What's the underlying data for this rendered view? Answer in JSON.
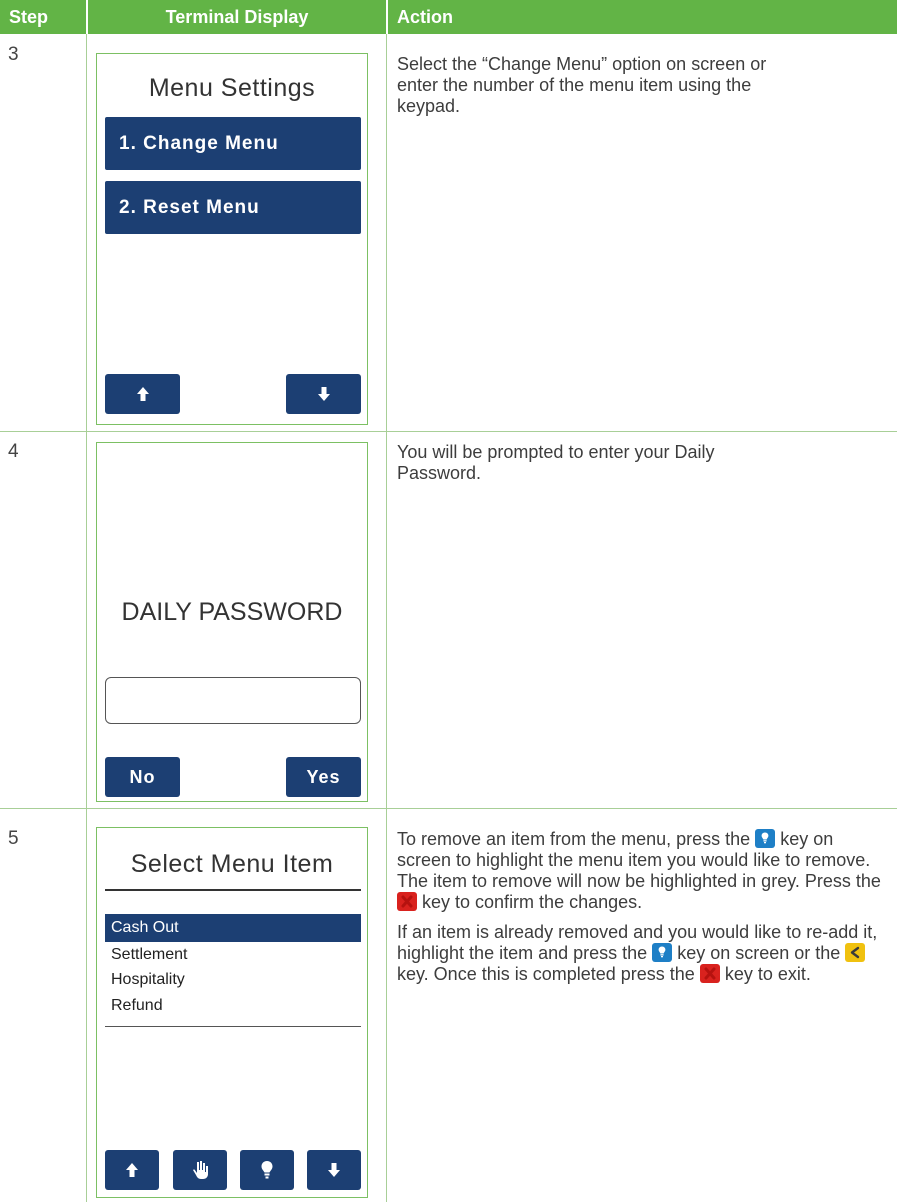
{
  "header": {
    "step": "Step",
    "terminal_display": "Terminal Display",
    "action": "Action"
  },
  "rows": [
    {
      "step": "3",
      "screen": {
        "title": "Menu Settings",
        "buttons": [
          "1. Change Menu",
          "2. Reset Menu"
        ],
        "nav": [
          "up-arrow-icon",
          "down-arrow-icon"
        ]
      },
      "action": "Select the “Change Menu” option on screen or enter the number of the menu item using the keypad."
    },
    {
      "step": "4",
      "screen": {
        "title": "DAILY PASSWORD",
        "input_value": "",
        "no_label": "No",
        "yes_label": "Yes"
      },
      "action": "You will be prompted to enter your Daily Password."
    },
    {
      "step": "5",
      "screen": {
        "title": "Select Menu Item",
        "items": [
          "Cash Out",
          "Settlement",
          "Hospitality",
          "Refund"
        ],
        "selected": "Cash Out",
        "nav": [
          "up-arrow-icon",
          "hand-icon",
          "lightbulb-icon",
          "down-arrow-icon"
        ]
      },
      "action_p1": {
        "a": "To remove an item from the menu, press the",
        "b": "key on screen to highlight the menu item you would like to remove. The item to remove will now be highlighted in grey. Press the",
        "c": "key to confirm the changes."
      },
      "action_p2": {
        "a": "If an item is already removed and you would like to re-add it, highlight the item and press the",
        "b": "key on screen or the",
        "c": "key. Once this is completed press the",
        "d": "key to exit."
      }
    }
  ],
  "colors": {
    "header_green": "#62b446",
    "terminal_blue": "#1c3f73",
    "key_blue": "#1e7fc6",
    "key_red": "#d9221e",
    "key_yellow": "#f0c10f"
  }
}
